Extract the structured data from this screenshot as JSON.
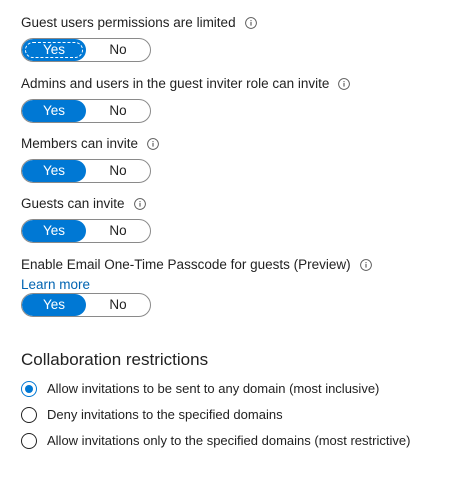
{
  "settings": [
    {
      "label": "Guest users permissions are limited",
      "yes_label": "Yes",
      "no_label": "No",
      "value": "Yes"
    },
    {
      "label": "Admins and users in the guest inviter role can invite",
      "yes_label": "Yes",
      "no_label": "No",
      "value": "Yes"
    },
    {
      "label": "Members can invite",
      "yes_label": "Yes",
      "no_label": "No",
      "value": "Yes"
    },
    {
      "label": "Guests can invite",
      "yes_label": "Yes",
      "no_label": "No",
      "value": "Yes"
    },
    {
      "label": "Enable Email One-Time Passcode for guests (Preview)",
      "link_text": "Learn more",
      "yes_label": "Yes",
      "no_label": "No",
      "value": "Yes"
    }
  ],
  "collaboration": {
    "heading": "Collaboration restrictions",
    "selected_index": 0,
    "options": [
      {
        "label": "Allow invitations to be sent to any domain (most inclusive)"
      },
      {
        "label": "Deny invitations to the specified domains"
      },
      {
        "label": "Allow invitations only to the specified domains (most restrictive)"
      }
    ]
  },
  "colors": {
    "accent": "#0078d4",
    "link": "#0063b1",
    "text": "#222222"
  },
  "icons": {
    "info": "info-icon"
  }
}
